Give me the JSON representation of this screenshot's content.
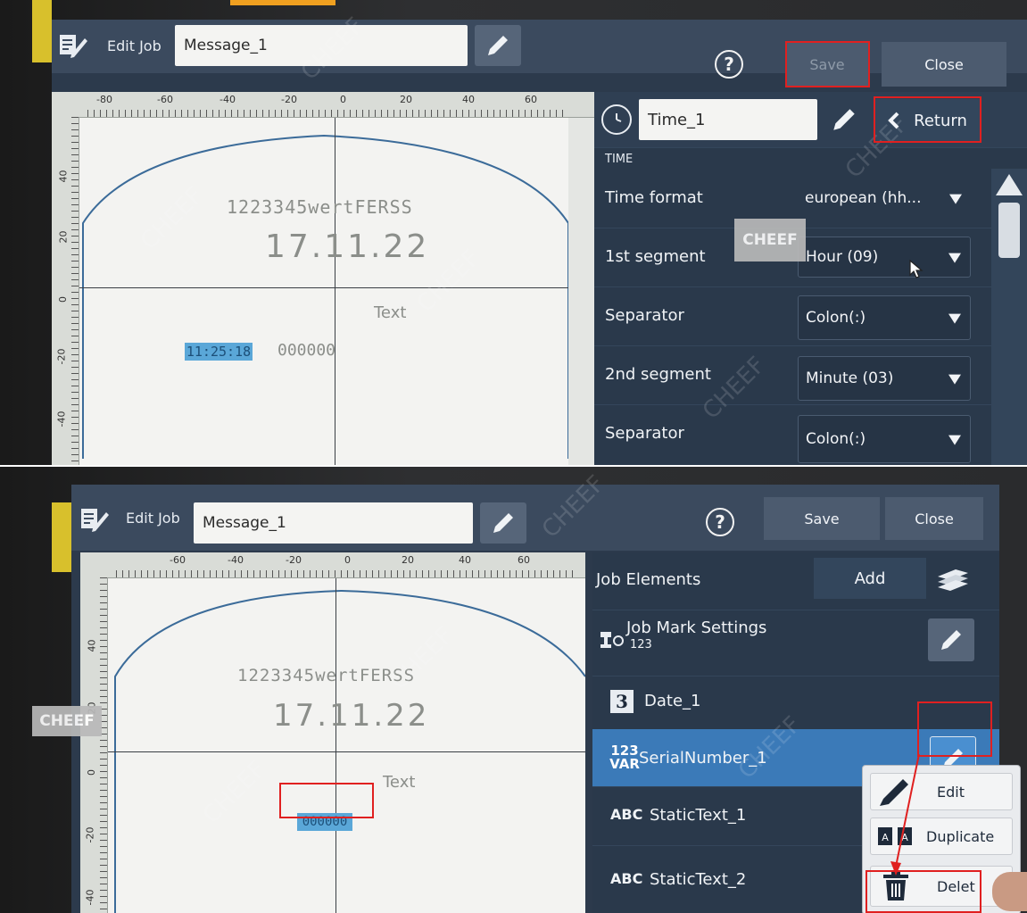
{
  "colors": {
    "accent": "#5aa7d8",
    "redbox": "#e02020",
    "panel": "#2a394b",
    "titlebar": "#3b4a5e",
    "selected_row": "#3b7ab8"
  },
  "shot1": {
    "header": {
      "edit_job_label": "Edit Job",
      "job_name": "Message_1",
      "help_label": "?",
      "save_label": "Save",
      "close_label": "Close",
      "icon": "edit-job-icon"
    },
    "ruler_top": [
      "-80",
      "-60",
      "-40",
      "-20",
      "0",
      "20",
      "40",
      "60"
    ],
    "ruler_left": [
      "40",
      "20",
      "0",
      "-20",
      "-40"
    ],
    "ruler_left_outer": [
      "40",
      "20",
      "0",
      "-20",
      "-40"
    ],
    "canvas": {
      "text_line": "1223345wertFERSS",
      "date_line": "17.11.22",
      "small_text": "Text",
      "time_selected": "11:25:18",
      "serial": "000000"
    },
    "panel": {
      "element_name": "Time_1",
      "return_label": "Return",
      "section": "TIME",
      "rows": [
        {
          "label": "Time format",
          "value": "european (hh..."
        },
        {
          "label": "1st segment",
          "value": "Hour (09)"
        },
        {
          "label": "Separator",
          "value": "Colon(:)"
        },
        {
          "label": "2nd segment",
          "value": "Minute (03)"
        },
        {
          "label": "Separator",
          "value": "Colon(:)"
        }
      ]
    },
    "watermark": "CHEEF"
  },
  "shot2": {
    "header": {
      "edit_job_label": "Edit Job",
      "job_name": "Message_1",
      "help_label": "?",
      "save_label": "Save",
      "close_label": "Close",
      "icon": "edit-job-icon"
    },
    "ruler_top": [
      "-60",
      "-40",
      "-20",
      "0",
      "20",
      "40",
      "60"
    ],
    "ruler_left": [
      "40",
      "20",
      "0",
      "-20",
      "-40"
    ],
    "ruler_left_outer": [
      "20",
      "0",
      "-20",
      "-40"
    ],
    "canvas": {
      "text_line": "1223345wertFERSS",
      "date_line": "17.11.22",
      "small_text": "Text",
      "serial_selected": "000000"
    },
    "panel": {
      "title": "Job Elements",
      "add_label": "Add",
      "items": [
        {
          "icon_text": "",
          "label": "Job Mark Settings",
          "sub": "123"
        },
        {
          "icon_text": "3",
          "label": "Date_1"
        },
        {
          "icon_text": "123\nVAR",
          "label": "SerialNumber_1"
        },
        {
          "icon_text": "ABC",
          "label": "StaticText_1"
        },
        {
          "icon_text": "ABC",
          "label": "StaticText_2"
        }
      ]
    },
    "context_menu": {
      "edit": "Edit",
      "duplicate": "Duplicate",
      "delete": "Delet"
    },
    "watermark": "CHEEF"
  }
}
